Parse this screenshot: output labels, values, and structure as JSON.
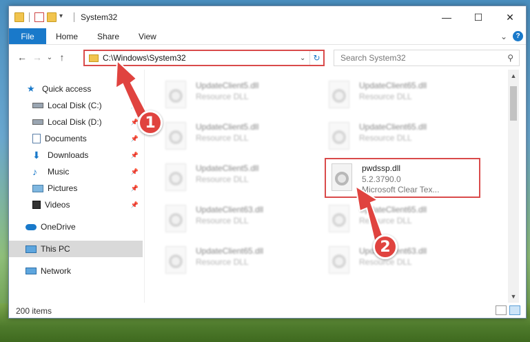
{
  "window": {
    "title": "System32",
    "controls": {
      "minimize": "—",
      "maximize": "☐",
      "close": "✕"
    }
  },
  "ribbon": {
    "file": "File",
    "tabs": [
      "Home",
      "Share",
      "View"
    ],
    "expand": "⌄",
    "help": "?"
  },
  "address": {
    "back": "←",
    "forward": "→",
    "recent": "⌄",
    "up": "↑",
    "path": "C:\\Windows\\System32",
    "dropdown": "⌄",
    "refresh": "↻",
    "search_placeholder": "Search System32",
    "search_icon": "⚲"
  },
  "nav": {
    "items": [
      {
        "label": "Quick access",
        "icon": "star-icon",
        "pinned": false
      },
      {
        "label": "Local Disk (C:)",
        "icon": "drive-icon",
        "pinned": true
      },
      {
        "label": "Local Disk (D:)",
        "icon": "drive-icon",
        "pinned": true
      },
      {
        "label": "Documents",
        "icon": "documents-icon",
        "pinned": true
      },
      {
        "label": "Downloads",
        "icon": "downloads-icon",
        "pinned": true
      },
      {
        "label": "Music",
        "icon": "music-icon",
        "pinned": true
      },
      {
        "label": "Pictures",
        "icon": "pictures-icon",
        "pinned": true
      },
      {
        "label": "Videos",
        "icon": "videos-icon",
        "pinned": true
      },
      {
        "label": "OneDrive",
        "icon": "cloud-icon",
        "pinned": false
      },
      {
        "label": "This PC",
        "icon": "pc-icon",
        "pinned": false,
        "selected": true
      },
      {
        "label": "Network",
        "icon": "network-icon",
        "pinned": false
      }
    ],
    "pin_glyph": "📌"
  },
  "files": [
    {
      "name": "UpdateClient5.dll",
      "desc": "Resource DLL",
      "blurred": true
    },
    {
      "name": "UpdateClient65.dll",
      "desc": "Resource DLL",
      "blurred": true
    },
    {
      "name": "UpdateClient5.dll",
      "desc": "Resource DLL",
      "blurred": true
    },
    {
      "name": "UpdateClient65.dll",
      "desc": "Resource DLL",
      "blurred": true
    },
    {
      "name": "UpdateClient5.dll",
      "desc": "Resource DLL",
      "blurred": true
    },
    {
      "name": "pwdssp.dll",
      "desc": "5.2.3790.0",
      "desc2": "Microsoft Clear Tex...",
      "blurred": false
    },
    {
      "name": "UpdateClient63.dll",
      "desc": "Resource DLL",
      "blurred": true
    },
    {
      "name": "UpdateClient65.dll",
      "desc": "Resource DLL",
      "blurred": true
    },
    {
      "name": "UpdateClient65.dll",
      "desc": "Resource DLL",
      "blurred": true
    },
    {
      "name": "UpdateClient63.dll",
      "desc": "Resource DLL",
      "blurred": true
    }
  ],
  "status": {
    "count": "200 items"
  },
  "annotations": {
    "marker1": "1",
    "marker2": "2"
  },
  "colors": {
    "accent": "#1979ca",
    "highlight": "#d94a4a",
    "marker": "#e0433f"
  }
}
